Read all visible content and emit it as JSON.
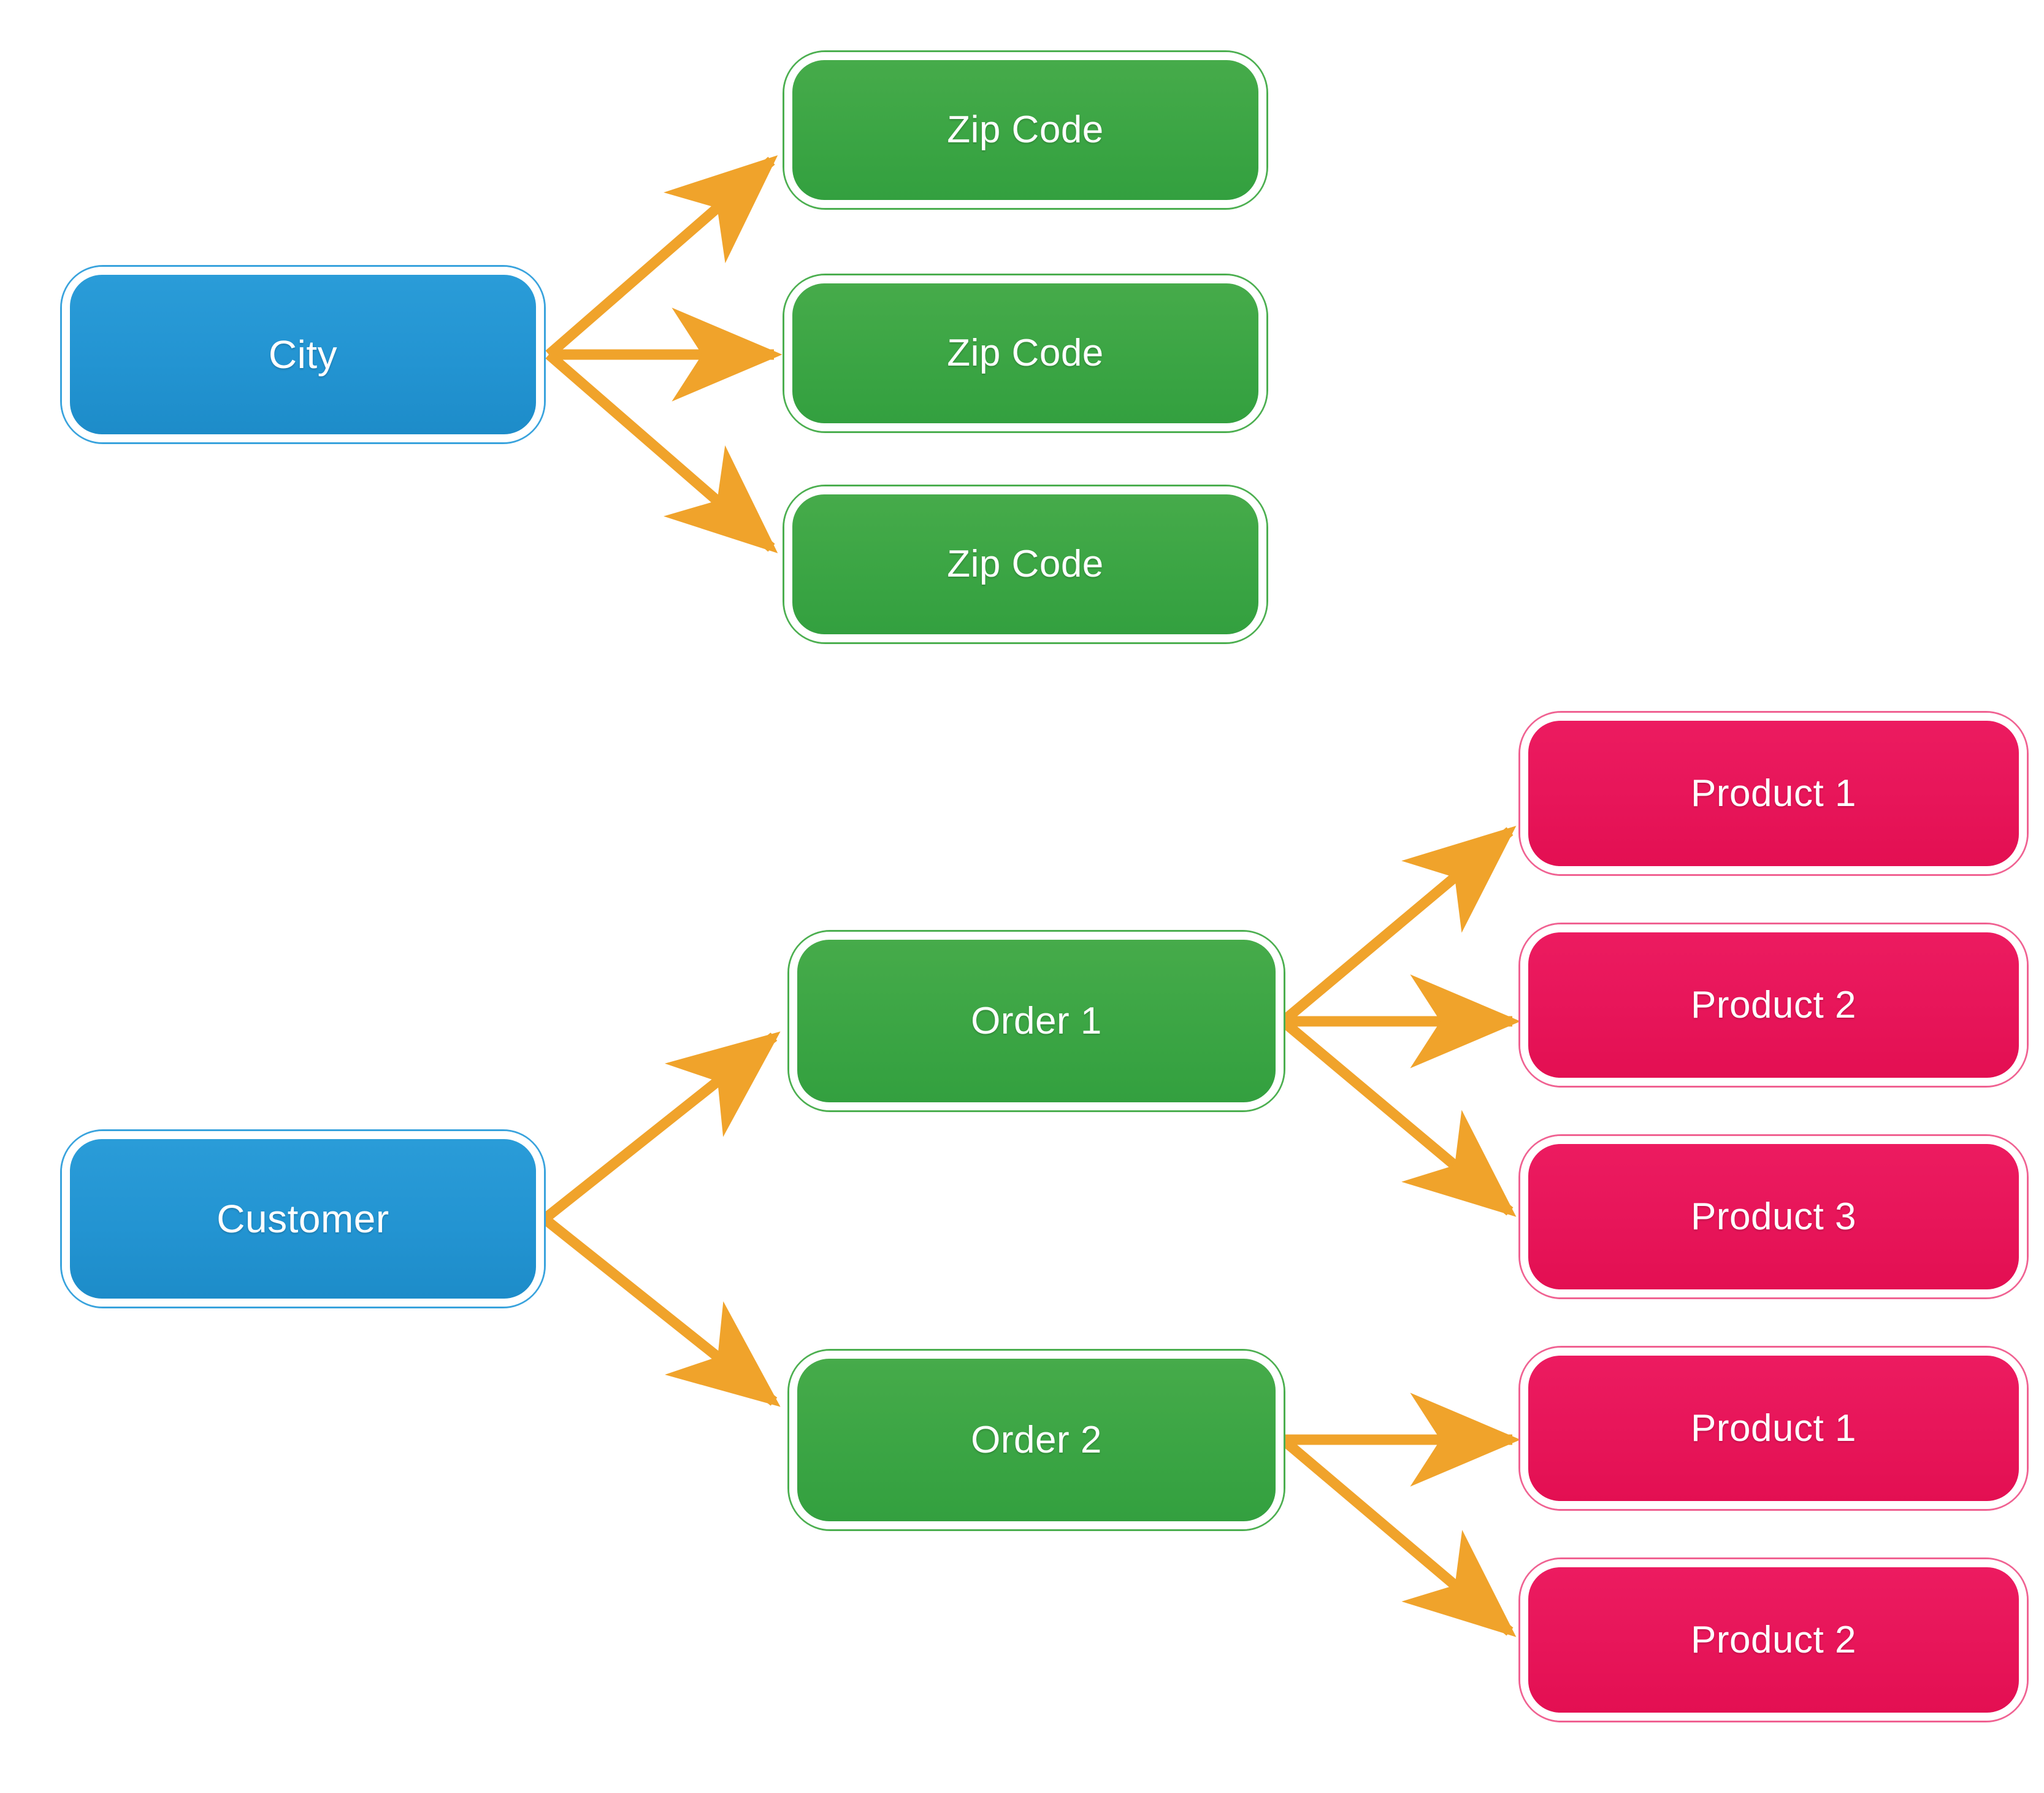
{
  "diagram": {
    "title": "Customer / City hierarchy diagram",
    "background_color": "#FFFFFF",
    "colors": {
      "level1_blue": "#2394D2",
      "level2_green": "#3BA544",
      "level3_crimson": "#E71559",
      "connector_orange": "#F0A32B",
      "node_text": "#FFFFFF",
      "node_outline_white": "#FFFFFF"
    },
    "groups": [
      {
        "name": "city-group",
        "root": "City",
        "children": [
          "Zip Code",
          "Zip Code",
          "Zip Code"
        ]
      },
      {
        "name": "customer-group",
        "root": "Customer",
        "children": [
          {
            "label": "Order 1",
            "children": [
              "Product 1",
              "Product 2",
              "Product 3"
            ]
          },
          {
            "label": "Order 2",
            "children": [
              "Product 1",
              "Product 2"
            ]
          }
        ]
      }
    ],
    "nodes": {
      "city": {
        "label": "City",
        "level": 1,
        "color": "#2394D2"
      },
      "zip1": {
        "label": "Zip Code",
        "level": 2,
        "color": "#3BA544"
      },
      "zip2": {
        "label": "Zip Code",
        "level": 2,
        "color": "#3BA544"
      },
      "zip3": {
        "label": "Zip Code",
        "level": 2,
        "color": "#3BA544"
      },
      "customer": {
        "label": "Customer",
        "level": 1,
        "color": "#2394D2"
      },
      "order1": {
        "label": "Order 1",
        "level": 2,
        "color": "#3BA544"
      },
      "order2": {
        "label": "Order 2",
        "level": 2,
        "color": "#3BA544"
      },
      "o1p1": {
        "label": "Product 1",
        "level": 3,
        "color": "#E71559"
      },
      "o1p2": {
        "label": "Product 2",
        "level": 3,
        "color": "#E71559"
      },
      "o1p3": {
        "label": "Product 3",
        "level": 3,
        "color": "#E71559"
      },
      "o2p1": {
        "label": "Product 1",
        "level": 3,
        "color": "#E71559"
      },
      "o2p2": {
        "label": "Product 2",
        "level": 3,
        "color": "#E71559"
      }
    },
    "connectors": [
      {
        "from": "city",
        "to": "zip1",
        "style": "arrow",
        "color": "#F0A32B"
      },
      {
        "from": "city",
        "to": "zip2",
        "style": "arrow",
        "color": "#F0A32B"
      },
      {
        "from": "city",
        "to": "zip3",
        "style": "arrow",
        "color": "#F0A32B"
      },
      {
        "from": "customer",
        "to": "order1",
        "style": "arrow",
        "color": "#F0A32B"
      },
      {
        "from": "customer",
        "to": "order2",
        "style": "arrow",
        "color": "#F0A32B"
      },
      {
        "from": "order1",
        "to": "o1p1",
        "style": "arrow",
        "color": "#F0A32B"
      },
      {
        "from": "order1",
        "to": "o1p2",
        "style": "arrow",
        "color": "#F0A32B"
      },
      {
        "from": "order1",
        "to": "o1p3",
        "style": "arrow",
        "color": "#F0A32B"
      },
      {
        "from": "order2",
        "to": "o2p1",
        "style": "arrow",
        "color": "#F0A32B"
      },
      {
        "from": "order2",
        "to": "o2p2",
        "style": "arrow",
        "color": "#F0A32B"
      }
    ]
  }
}
